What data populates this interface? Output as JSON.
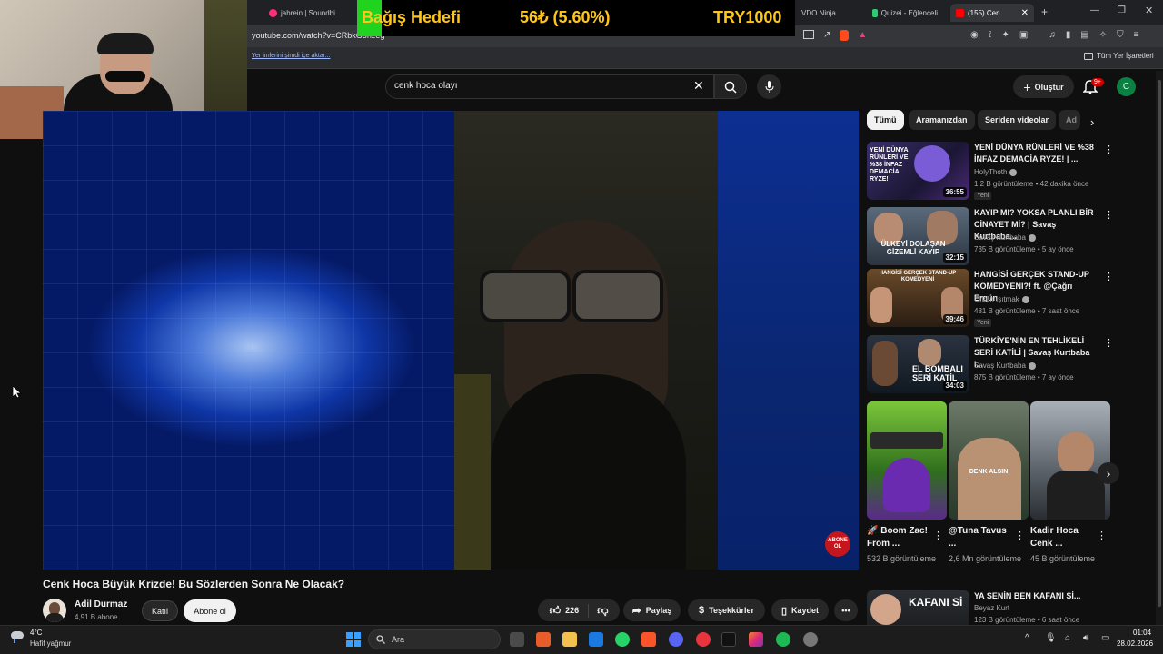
{
  "browser": {
    "tabs": [
      {
        "label": "jahrein | Soundbi",
        "color": "#ff2d7a"
      },
      {
        "label": "VDO.Ninja",
        "color": "#5a9cff"
      },
      {
        "label": "Quizei - Eğlenceli",
        "color": "#2ecc71"
      },
      {
        "label": "(155) Cen",
        "color": "#ff0000"
      }
    ],
    "url": "youtube.com/watch?v=CRbkG3hzeg",
    "import_bookmarks": "Yer imlerini şimdi içe aktar...",
    "all_bookmarks": "Tüm Yer İşaretleri"
  },
  "overlay": {
    "label": "Bağış Hedefi",
    "amount": "56₺ (5.60%)",
    "goal": "TRY1000"
  },
  "youtube": {
    "search_query": "cenk hoca olayı",
    "create_label": "Oluştur",
    "notif_count": "9+",
    "avatar_letter": "C",
    "video": {
      "title": "Cenk Hoca Büyük Krizde! Bu Sözlerden Sonra Ne Olacak?",
      "subscribe_overlay": "ABONE OL",
      "channel": "Adil Durmaz",
      "subs": "4,91 B abone",
      "join": "Katıl",
      "subscribe": "Abone ol",
      "likes": "226",
      "share": "Paylaş",
      "thanks": "Teşekkürler",
      "save": "Kaydet"
    },
    "chips": [
      "Tümü",
      "Aramanızdan",
      "Seriden videolar",
      "Ad"
    ],
    "recommendations": [
      {
        "title": "YENİ DÜNYA RÜNLERİ VE %38 İNFAZ DEMACİA RYZE! | ...",
        "channel": "HolyThoth",
        "meta": "1,2 B görüntüleme • 42 dakika önce",
        "badge": "Yeni",
        "duration": "36:55",
        "thumb_text": "YENİ DÜNYA RÜNLERİ VE %38 İNFAZ DEMACİA RYZE!"
      },
      {
        "title": "KAYIP MI? YOKSA PLANLI BİR CİNAYET Mİ? | Savaş Kurtbaba...",
        "channel": "Savaş Kurtbaba",
        "meta": "735 B görüntüleme • 5 ay önce",
        "badge": "",
        "duration": "32:15",
        "thumb_text": "ÜLKEYİ DOLAŞAN GİZEMLİ KAYIP"
      },
      {
        "title": "HANGİSİ GERÇEK STAND-UP KOMEDYENİ?! ft. @Çağrı Ergün",
        "channel": "Orkun Işıtmak",
        "meta": "481 B görüntüleme • 7 saat önce",
        "badge": "Yeni",
        "duration": "39:46",
        "thumb_text": "HANGİSİ GERÇEK STAND-UP KOMEDYENİ"
      },
      {
        "title": "TÜRKİYE'NİN EN TEHLİKELİ SERİ KATİLİ | Savaş Kurtbaba i...",
        "channel": "Savaş Kurtbaba",
        "meta": "875 B görüntüleme • 7 ay önce",
        "badge": "",
        "duration": "34:03",
        "thumb_text": "EL BOMBALI SERİ KATİL"
      }
    ],
    "shorts": [
      {
        "title": "🚀 Boom Zac! From ...",
        "views": "532 B görüntüleme"
      },
      {
        "title": "@Tuna Tavus ...",
        "views": "2,6 Mn görüntüleme",
        "thumb_text": "DENK ALSIN"
      },
      {
        "title": "Kadir Hoca Cenk ...",
        "views": "45 B görüntüleme"
      }
    ],
    "bottom_rec": {
      "title": "YA SENİN BEN KAFANI Sİ...",
      "channel": "Beyaz Kurt",
      "meta": "123 B görüntüleme • 6 saat önce",
      "thumb_text": "KAFANI Sİ"
    }
  },
  "taskbar": {
    "temp": "4°C",
    "weather": "Hafif yağmur",
    "search": "Ara",
    "time": "01:04",
    "date": "28.02.2026"
  },
  "colors": {
    "youtube_red": "#ff0000",
    "overlay_text": "#ffc61a",
    "overlay_green": "#1fd31f"
  }
}
